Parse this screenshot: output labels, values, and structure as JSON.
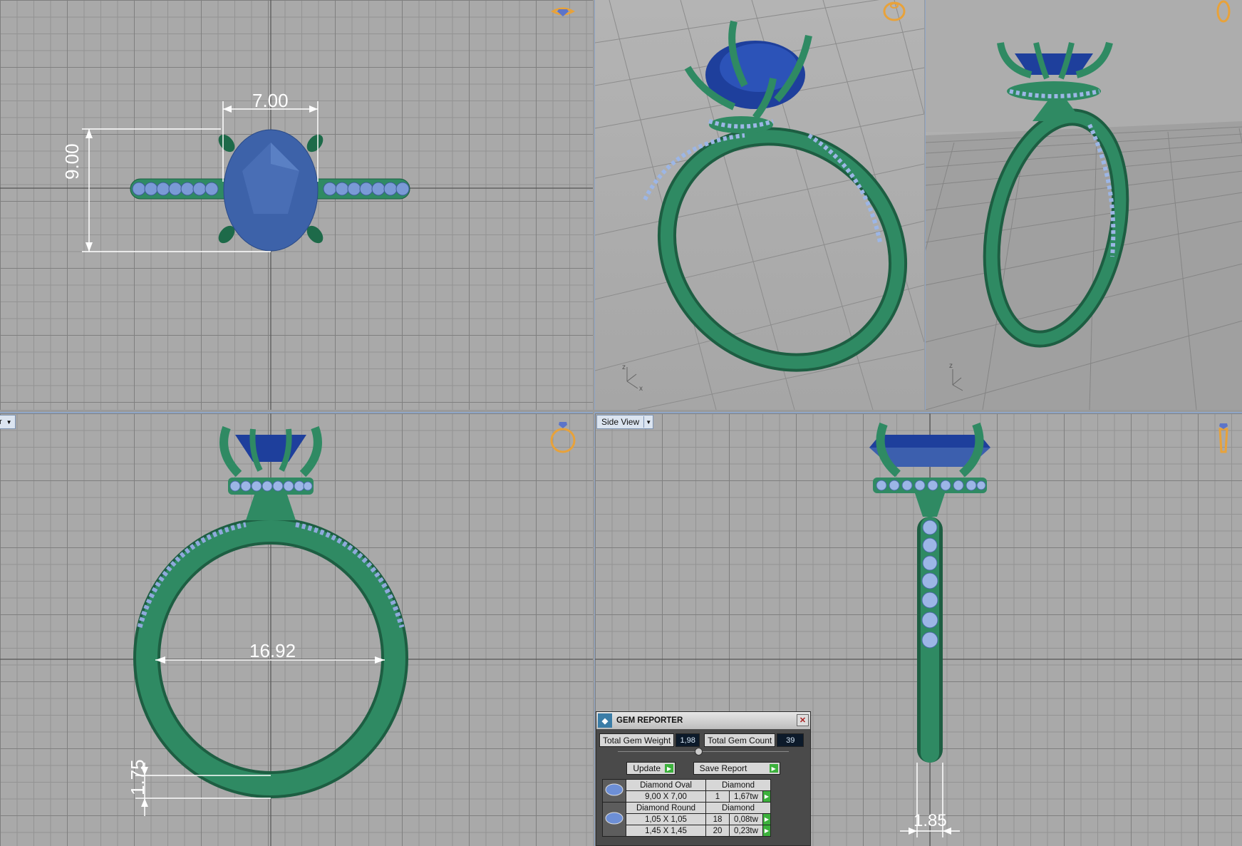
{
  "viewports": {
    "top": {
      "dim_width": "7.00",
      "dim_height": "9.00"
    },
    "perspective": {
      "axis_z": "z",
      "axis_x": "x"
    },
    "right": {
      "axis_z": "z"
    },
    "front": {
      "label_cut": "r",
      "dim_inner": "16.92",
      "dim_shank": "1.75"
    },
    "side": {
      "label": "Side View",
      "dim_shank": "1.85"
    }
  },
  "gem_reporter": {
    "title": "GEM REPORTER",
    "total_weight_label": "Total Gem Weight",
    "total_weight_value": "1,98",
    "total_count_label": "Total Gem Count",
    "total_count_value": "39",
    "update_label": "Update",
    "save_label": "Save Report",
    "rows": [
      {
        "name": "Diamond Oval",
        "material": "Diamond",
        "size": "9,00 X 7,00",
        "count": "1",
        "weight": "1,67tw"
      },
      {
        "name": "Diamond Round",
        "material": "Diamond",
        "size": "1,05 X 1,05",
        "count": "18",
        "weight": "0,08tw"
      },
      {
        "name": "",
        "material": "",
        "size": "1,45 X 1,45",
        "count": "20",
        "weight": "0,23tw"
      }
    ]
  },
  "colors": {
    "metal": "#2f8a63",
    "metal_dark": "#1d5e42",
    "gem_blue": "#3a5fa8",
    "accent_orange": "#e8a23a",
    "divider": "#8fa6c7"
  }
}
